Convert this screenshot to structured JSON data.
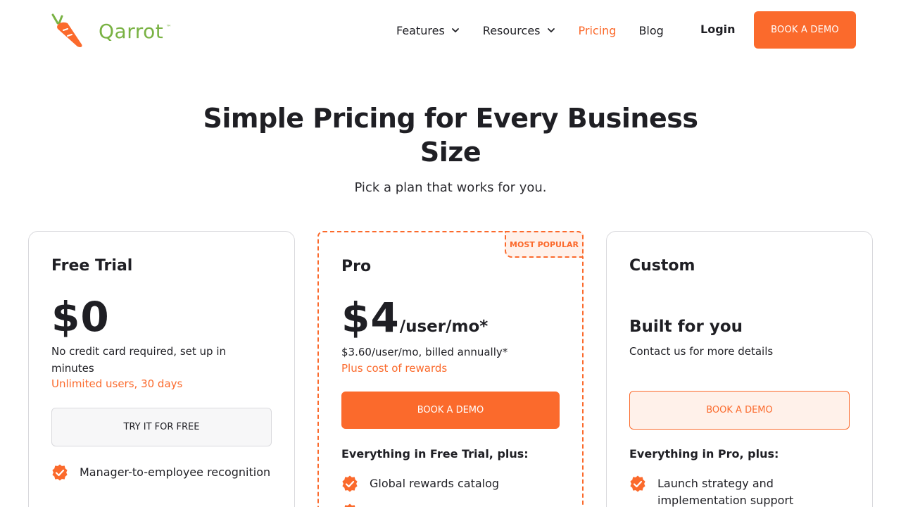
{
  "brand": {
    "name": "Qarrot",
    "tm": "™",
    "accent": "#fb6a2c",
    "logo_green": "#79b243"
  },
  "nav": {
    "items": [
      {
        "label": "Features",
        "dropdown": true
      },
      {
        "label": "Resources",
        "dropdown": true
      },
      {
        "label": "Pricing",
        "active": true
      },
      {
        "label": "Blog"
      }
    ],
    "login": "Login",
    "demo": "BOOK A DEMO"
  },
  "hero": {
    "title": "Simple Pricing for Every Business Size",
    "subtitle": "Pick a plan that works for you."
  },
  "plans": {
    "free": {
      "name": "Free Trial",
      "price": "$0",
      "desc": "No credit card required, set up in minutes",
      "accent": "Unlimited users, 30 days",
      "button": "TRY IT FOR FREE",
      "features": [
        "Manager-to-employee recognition"
      ]
    },
    "pro": {
      "badge": "MOST POPULAR",
      "name": "Pro",
      "price": "$4",
      "unit": "/user/mo*",
      "desc": "$3.60/user/mo, billed annually*",
      "accent": "Plus cost of rewards",
      "button": "BOOK A DEMO",
      "includes": "Everything in Free Trial, plus:",
      "features": [
        "Global rewards catalog"
      ]
    },
    "custom": {
      "name": "Custom",
      "headline": "Built for you",
      "desc": "Contact us for more details",
      "button": "BOOK A DEMO",
      "includes": "Everything in Pro, plus:",
      "features": [
        "Launch strategy and implementation support"
      ]
    }
  },
  "icons": {
    "chevron": "chevron-down-icon",
    "check": "check-badge-icon",
    "logo": "carrot-logo-icon"
  }
}
